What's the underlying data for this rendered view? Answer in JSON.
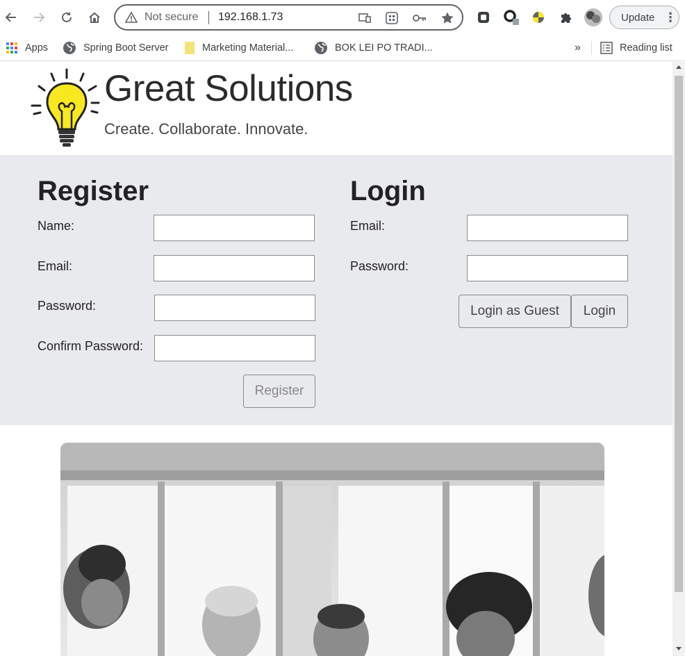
{
  "browser": {
    "security_label": "Not secure",
    "url": "192.168.1.73",
    "update_label": "Update",
    "more_label": "⋮",
    "bookmarks": [
      {
        "label": "Apps"
      },
      {
        "label": "Spring Boot Server"
      },
      {
        "label": "Marketing Material..."
      },
      {
        "label": "BOK LEI PO TRADI..."
      }
    ],
    "overflow_label": "»",
    "reading_list_label": "Reading list"
  },
  "site": {
    "title": "Great Solutions",
    "tagline": "Create. Collaborate. Innovate."
  },
  "register": {
    "heading": "Register",
    "name_label": "Name:",
    "name_value": "",
    "email_label": "Email:",
    "email_value": "",
    "password_label": "Password:",
    "password_value": "",
    "confirm_label": "Confirm Password:",
    "confirm_value": "",
    "button_label": "Register"
  },
  "login": {
    "heading": "Login",
    "email_label": "Email:",
    "email_value": "",
    "password_label": "Password:",
    "password_value": "",
    "guest_button_label": "Login as Guest",
    "login_button_label": "Login"
  },
  "colors": {
    "form_panel_bg": "#e9eaee",
    "bulb_yellow": "#f7e81f"
  }
}
